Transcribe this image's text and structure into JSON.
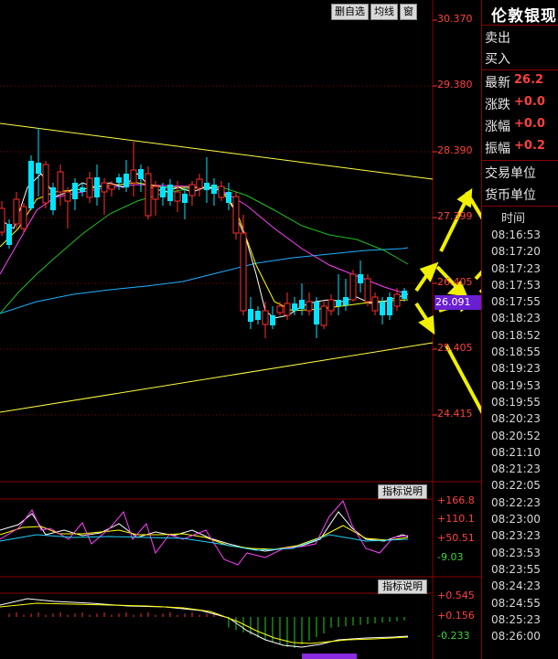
{
  "toolbar": {
    "btn_delete_watch": "删自选",
    "btn_ma": "均线",
    "btn_window": "窗"
  },
  "price_axis": [
    "30.370",
    "29.380",
    "28.390",
    "27.399",
    "26.405",
    "25.405",
    "24.415"
  ],
  "current_price_tag": "26.091",
  "indicator1": {
    "button": "指标说明",
    "axis": [
      "+166.8",
      "+110.1",
      "+50.51",
      "-9.03"
    ]
  },
  "indicator2": {
    "button": "指标说明",
    "axis": [
      "+0.545",
      "+0.156",
      "-0.233"
    ]
  },
  "sidebar": {
    "title": "伦敦银现",
    "sell_label": "卖出",
    "buy_label": "买入",
    "latest_label": "最新",
    "latest_value": "26.2",
    "change_label": "涨跌",
    "change_value": "+0.0",
    "change_pct_label": "涨幅",
    "change_pct_value": "+0.0",
    "amplitude_label": "振幅",
    "amplitude_value": "+0.2",
    "trade_unit_label": "交易单位",
    "currency_unit_label": "货币单位",
    "time_header": "时间",
    "times": [
      "08:16:53",
      "08:17:20",
      "08:17:23",
      "08:17:53",
      "08:17:55",
      "08:18:23",
      "08:18:52",
      "08:18:55",
      "08:19:23",
      "08:19:53",
      "08:19:55",
      "08:20:23",
      "08:20:52",
      "08:21:10",
      "08:21:23",
      "08:22:05",
      "08:22:23",
      "08:23:00",
      "08:23:23",
      "08:23:53",
      "08:23:55",
      "08:24:23",
      "08:24:55",
      "08:25:23",
      "08:26:00"
    ]
  },
  "colors": {
    "up": "#ff3030",
    "down": "#00e5ff",
    "trendline": "#ffff40",
    "ma_white": "#ffffff",
    "ma_yellow": "#ffff00",
    "ma_magenta": "#ff40ff",
    "ma_green": "#20c020",
    "ma_cyan": "#20b0ff",
    "arrow": "#f0f000"
  }
}
